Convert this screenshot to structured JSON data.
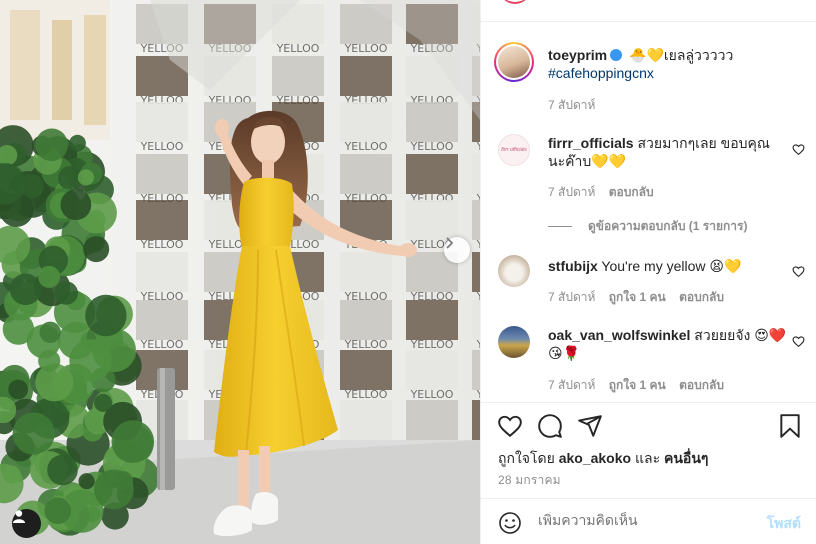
{
  "post": {
    "author": {
      "username": "toeyprim",
      "caption_emoji": "🐣💛",
      "caption_text": "เยลลู่ววววว",
      "hashtag": "#cafehoppingcnx",
      "time": "7 สัปดาห์"
    },
    "photo": {
      "wall_label": "YELLOO"
    }
  },
  "comments": [
    {
      "username": "firrr_officials",
      "avatar_text": "firrr officials",
      "text": "สวยมากๆเลย ขอบคุณนะค๊าบ💛💛",
      "time": "7 สัปดาห์",
      "reply_label": "ตอบกลับ",
      "view_replies": "ดูข้อความตอบกลับ (1 รายการ)"
    },
    {
      "username": "stfubijx",
      "text": "You're my yellow 😫💛",
      "time": "7 สัปดาห์",
      "likes_label": "ถูกใจ 1 คน",
      "reply_label": "ตอบกลับ"
    },
    {
      "username": "oak_van_wolfswinkel",
      "text": "สวยยยจัง 😍❤️😘🌹",
      "time": "7 สัปดาห์",
      "likes_label": "ถูกใจ 1 คน",
      "reply_label": "ตอบกลับ"
    }
  ],
  "liked_by": {
    "prefix": "ถูกใจโดย",
    "user": "ako_akoko",
    "and": "และ",
    "others": "คนอื่นๆ"
  },
  "posted_date": "28 มกราคม",
  "composer": {
    "placeholder": "เพิ่มความคิดเห็น",
    "post_label": "โพสต์"
  },
  "colors": {
    "dress": "#f2c72a",
    "link": "#00376b",
    "verified": "#3897f0",
    "post_disabled": "#b2dffc",
    "muted": "#8e8e8e"
  }
}
